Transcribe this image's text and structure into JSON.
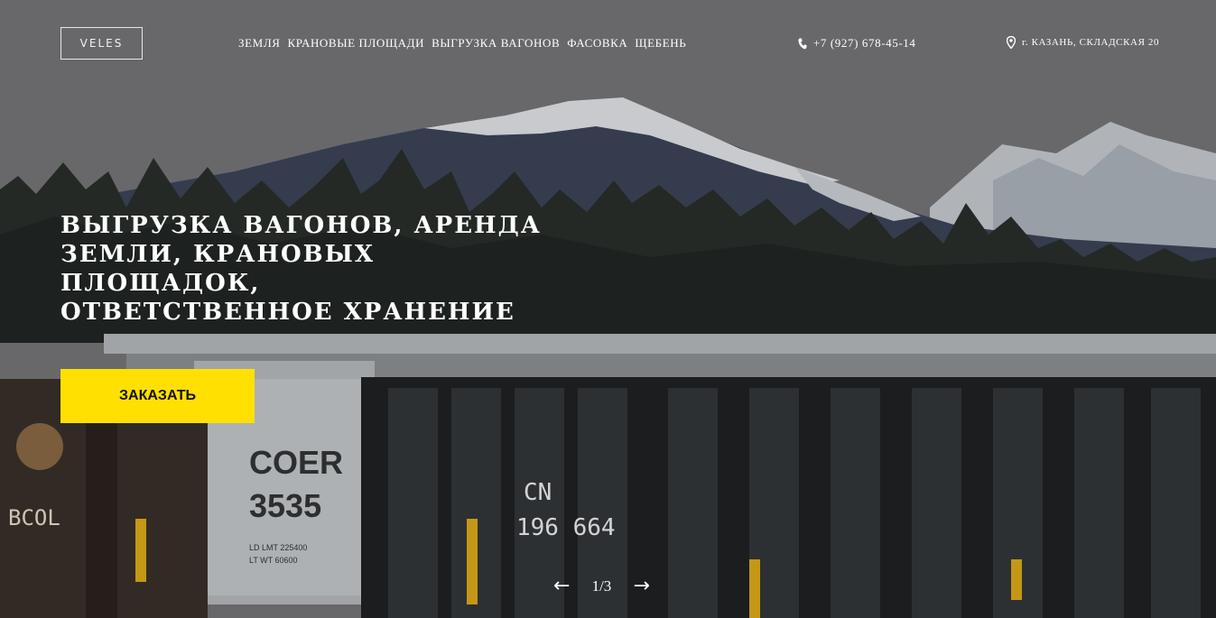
{
  "header": {
    "logo": "VELES",
    "nav": [
      "ЗЕМЛЯ",
      "КРАНОВЫЕ ПЛОЩАДИ",
      "ВЫГРУЗКА ВАГОНОВ",
      "ФАСОВКА",
      "ЩЕБЕНЬ"
    ],
    "phone": "+7 (927) 678-45-14",
    "address": "г. КАЗАНЬ, СКЛАДСКАЯ 20"
  },
  "hero": {
    "headline_lines": [
      "ВЫГРУЗКА ВАГОНОВ, АРЕНДА",
      "ЗЕМЛИ, КРАНОВЫХ ПЛОЩАДОК,",
      "ОТВЕТСТВЕННОЕ ХРАНЕНИЕ"
    ],
    "cta": "ЗАКАЗАТЬ",
    "background_texts": [
      "BCOL",
      "COER",
      "3535",
      "LD LMT 225400",
      "LT WT 60600",
      "CN",
      "196 664"
    ]
  },
  "slider": {
    "prev": "←",
    "counter": "1/3",
    "next": "→"
  },
  "colors": {
    "accent": "#ffe000",
    "overlay": "#6a6a6a"
  },
  "icons": {
    "phone": "phone-icon",
    "address": "map-pin-icon",
    "prev": "arrow-left-icon",
    "next": "arrow-right-icon"
  }
}
